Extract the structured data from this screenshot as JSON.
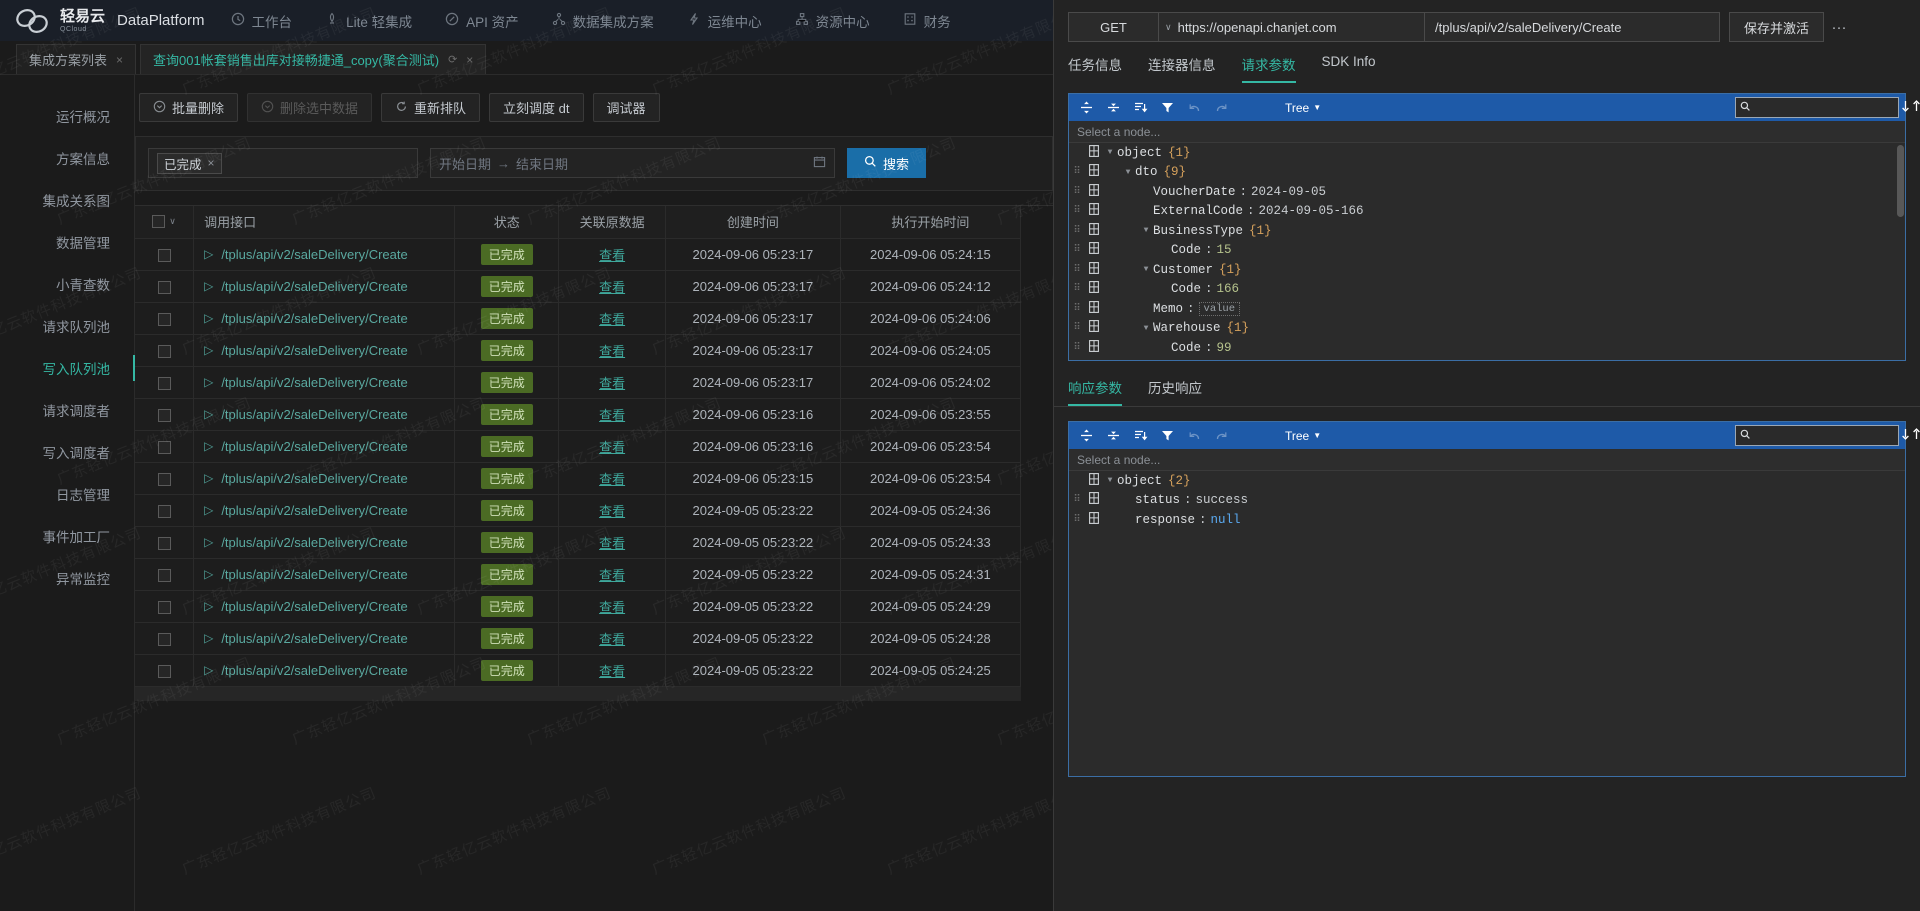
{
  "brand": {
    "cn": "轻易云",
    "sub": "QCloud",
    "en": "DataPlatform"
  },
  "topnav": [
    {
      "label": "工作台",
      "icon": "clock-icon"
    },
    {
      "label": "Lite 轻集成",
      "icon": "rocket-icon"
    },
    {
      "label": "API 资产",
      "icon": "compass-icon"
    },
    {
      "label": "数据集成方案",
      "icon": "network-icon"
    },
    {
      "label": "运维中心",
      "icon": "bolt-icon"
    },
    {
      "label": "资源中心",
      "icon": "sitemap-icon"
    },
    {
      "label": "财务",
      "icon": "calculator-icon"
    }
  ],
  "tabs": [
    {
      "label": "集成方案列表",
      "active": false,
      "close": "×"
    },
    {
      "label": "查询001帐套销售出库对接畅捷通_copy(聚合测试)",
      "active": true,
      "close": "×",
      "reload": "⟳"
    }
  ],
  "sidebar": {
    "items": [
      {
        "label": "运行概况",
        "active": false
      },
      {
        "label": "方案信息",
        "active": false
      },
      {
        "label": "集成关系图",
        "active": false
      },
      {
        "label": "数据管理",
        "active": false
      },
      {
        "label": "小青查数",
        "active": false
      },
      {
        "label": "请求队列池",
        "active": false
      },
      {
        "label": "写入队列池",
        "active": true
      },
      {
        "label": "请求调度者",
        "active": false
      },
      {
        "label": "写入调度者",
        "active": false
      },
      {
        "label": "日志管理",
        "active": false
      },
      {
        "label": "事件加工厂",
        "active": false
      },
      {
        "label": "异常监控",
        "active": false
      }
    ]
  },
  "toolbar": {
    "buttons": [
      {
        "label": "批量删除",
        "icon": "minus-circle-icon",
        "disabled": false
      },
      {
        "label": "删除选中数据",
        "icon": "minus-circle-icon",
        "disabled": true
      },
      {
        "label": "重新排队",
        "icon": "refresh-icon",
        "disabled": false
      },
      {
        "label": "立刻调度 dt",
        "icon": "",
        "disabled": false
      },
      {
        "label": "调试器",
        "icon": "",
        "disabled": false
      }
    ]
  },
  "filters": {
    "status_chip": "已完成",
    "status_chip_close": "×",
    "status_placeholder": "",
    "date_start_placeholder": "开始日期",
    "date_sep": "→",
    "date_end_placeholder": "结束日期",
    "calendar_icon": "calendar-icon",
    "search_label": "搜索",
    "search_icon": "search-icon"
  },
  "table": {
    "columns": [
      "",
      "调用接口",
      "状态",
      "关联原数据",
      "创建时间",
      "执行开始时间"
    ],
    "link_label": "查看",
    "rows": [
      {
        "api": "/tplus/api/v2/saleDelivery/Create",
        "state": "已完成",
        "created": "2024-09-06 05:23:17",
        "started": "2024-09-06 05:24:15"
      },
      {
        "api": "/tplus/api/v2/saleDelivery/Create",
        "state": "已完成",
        "created": "2024-09-06 05:23:17",
        "started": "2024-09-06 05:24:12"
      },
      {
        "api": "/tplus/api/v2/saleDelivery/Create",
        "state": "已完成",
        "created": "2024-09-06 05:23:17",
        "started": "2024-09-06 05:24:06"
      },
      {
        "api": "/tplus/api/v2/saleDelivery/Create",
        "state": "已完成",
        "created": "2024-09-06 05:23:17",
        "started": "2024-09-06 05:24:05"
      },
      {
        "api": "/tplus/api/v2/saleDelivery/Create",
        "state": "已完成",
        "created": "2024-09-06 05:23:17",
        "started": "2024-09-06 05:24:02"
      },
      {
        "api": "/tplus/api/v2/saleDelivery/Create",
        "state": "已完成",
        "created": "2024-09-06 05:23:16",
        "started": "2024-09-06 05:23:55"
      },
      {
        "api": "/tplus/api/v2/saleDelivery/Create",
        "state": "已完成",
        "created": "2024-09-06 05:23:16",
        "started": "2024-09-06 05:23:54"
      },
      {
        "api": "/tplus/api/v2/saleDelivery/Create",
        "state": "已完成",
        "created": "2024-09-06 05:23:15",
        "started": "2024-09-06 05:23:54"
      },
      {
        "api": "/tplus/api/v2/saleDelivery/Create",
        "state": "已完成",
        "created": "2024-09-05 05:23:22",
        "started": "2024-09-05 05:24:36"
      },
      {
        "api": "/tplus/api/v2/saleDelivery/Create",
        "state": "已完成",
        "created": "2024-09-05 05:23:22",
        "started": "2024-09-05 05:24:33"
      },
      {
        "api": "/tplus/api/v2/saleDelivery/Create",
        "state": "已完成",
        "created": "2024-09-05 05:23:22",
        "started": "2024-09-05 05:24:31"
      },
      {
        "api": "/tplus/api/v2/saleDelivery/Create",
        "state": "已完成",
        "created": "2024-09-05 05:23:22",
        "started": "2024-09-05 05:24:29"
      },
      {
        "api": "/tplus/api/v2/saleDelivery/Create",
        "state": "已完成",
        "created": "2024-09-05 05:23:22",
        "started": "2024-09-05 05:24:28"
      },
      {
        "api": "/tplus/api/v2/saleDelivery/Create",
        "state": "已完成",
        "created": "2024-09-05 05:23:22",
        "started": "2024-09-05 05:24:25"
      }
    ]
  },
  "request_panel": {
    "method": "GET",
    "host": "https://openapi.chanjet.com",
    "path": "/tplus/api/v2/saleDelivery/Create",
    "save_label": "保存并激活",
    "more_label": "···",
    "tabs": [
      {
        "label": "任务信息",
        "active": false
      },
      {
        "label": "连接器信息",
        "active": false
      },
      {
        "label": "请求参数",
        "active": true
      },
      {
        "label": "SDK Info",
        "active": false
      }
    ],
    "editor": {
      "mode_label": "Tree",
      "path_placeholder": "Select a node...",
      "search_placeholder": "",
      "tree": [
        {
          "depth": 0,
          "caret": "▼",
          "key": "object",
          "count": "{1}",
          "drag": false,
          "type": "object"
        },
        {
          "depth": 1,
          "caret": "▼",
          "key": "dto",
          "count": "{9}",
          "drag": true,
          "type": "object"
        },
        {
          "depth": 2,
          "caret": "",
          "key": "VoucherDate",
          "value": "2024-09-05",
          "drag": true,
          "type": "string"
        },
        {
          "depth": 2,
          "caret": "",
          "key": "ExternalCode",
          "value": "2024-09-05-166",
          "drag": true,
          "type": "string"
        },
        {
          "depth": 2,
          "caret": "▼",
          "key": "BusinessType",
          "count": "{1}",
          "drag": true,
          "type": "object"
        },
        {
          "depth": 3,
          "caret": "",
          "key": "Code",
          "value": "15",
          "drag": true,
          "type": "number"
        },
        {
          "depth": 2,
          "caret": "▼",
          "key": "Customer",
          "count": "{1}",
          "drag": true,
          "type": "object"
        },
        {
          "depth": 3,
          "caret": "",
          "key": "Code",
          "value": "166",
          "drag": true,
          "type": "number"
        },
        {
          "depth": 2,
          "caret": "",
          "key": "Memo",
          "value": "value",
          "drag": true,
          "type": "placeholder"
        },
        {
          "depth": 2,
          "caret": "▼",
          "key": "Warehouse",
          "count": "{1}",
          "drag": true,
          "type": "object"
        },
        {
          "depth": 3,
          "caret": "",
          "key": "Code",
          "value": "99",
          "drag": true,
          "type": "number"
        }
      ]
    }
  },
  "response_panel": {
    "tabs": [
      {
        "label": "响应参数",
        "active": true
      },
      {
        "label": "历史响应",
        "active": false
      }
    ],
    "editor": {
      "mode_label": "Tree",
      "path_placeholder": "Select a node...",
      "search_placeholder": "",
      "tree": [
        {
          "depth": 0,
          "caret": "▼",
          "key": "object",
          "count": "{2}",
          "drag": false,
          "type": "object"
        },
        {
          "depth": 1,
          "caret": "",
          "key": "status",
          "value": "success",
          "drag": true,
          "type": "string"
        },
        {
          "depth": 1,
          "caret": "",
          "key": "response",
          "value": "null",
          "drag": true,
          "type": "null"
        }
      ]
    }
  },
  "watermark_text": "广东轻亿云软件科技有限公司",
  "colors": {
    "accent": "#35b8a4",
    "editor_menu": "#1e5aa8",
    "badge_bg": "#4b6b24",
    "search_btn": "#1a6ea8"
  }
}
